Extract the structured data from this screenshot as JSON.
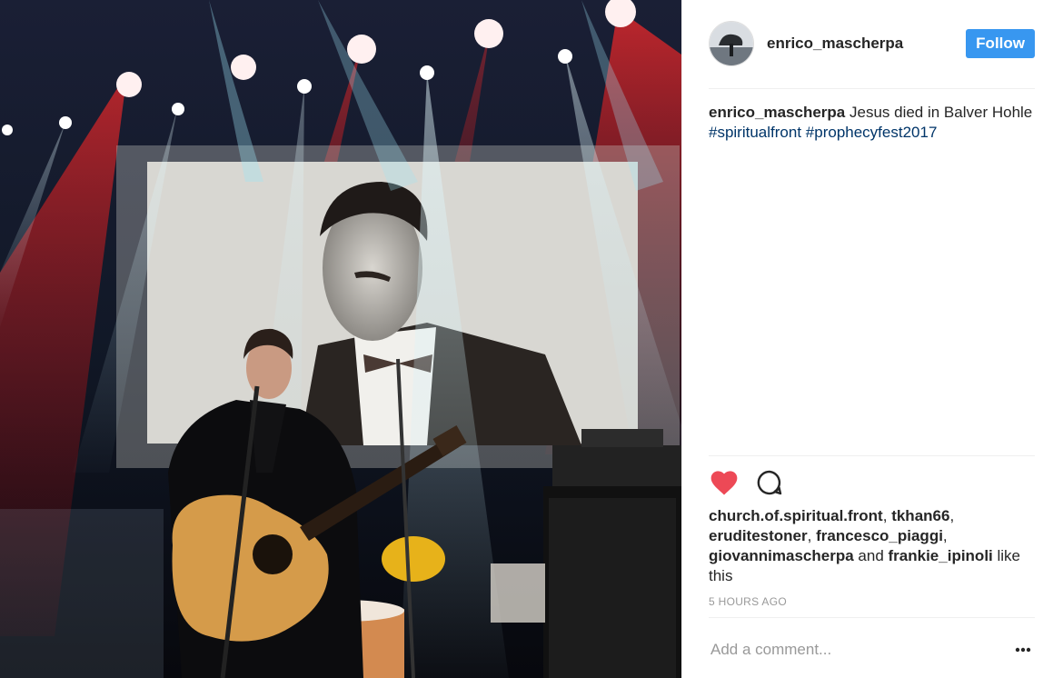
{
  "post": {
    "photo_alt": "",
    "author": "enrico_mascherpa",
    "follow_label": "Follow",
    "caption_text": "Jesus died in Balver Hohle",
    "hashtags": [
      "#spiritualfront",
      "#prophecyfest2017"
    ],
    "like_icon": "heart-filled-icon",
    "comment_icon": "comment-bubble-icon",
    "more_icon": "more-dots-icon",
    "likers": [
      "church.of.spiritual.front",
      "tkhan66",
      "eruditestoner",
      "francesco_piaggi",
      "giovannimascherpa",
      "frankie_ipinoli"
    ],
    "likes_sep": ", ",
    "likes_and": "and",
    "likes_suffix": "like this",
    "timestamp": "5 HOURS AGO",
    "comment_placeholder": "Add a comment...",
    "colors": {
      "accent": "#3897f0",
      "heart": "#ed4956",
      "hashtag": "#003569",
      "muted": "#999999"
    }
  }
}
